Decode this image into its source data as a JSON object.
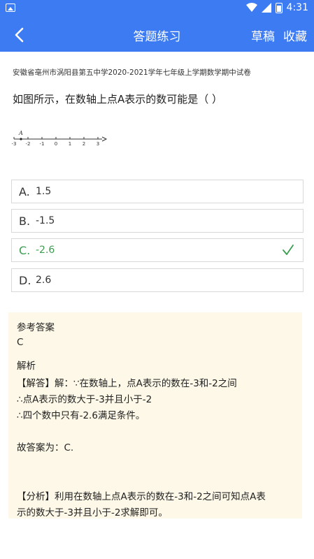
{
  "status_bar": {
    "time": "4:31"
  },
  "header": {
    "title": "答题练习",
    "actions": {
      "draft": "草稿",
      "favorite": "收藏"
    }
  },
  "question": {
    "source": "安徽省亳州市涡阳县第五中学2020-2021学年七年级上学期数学期中试卷",
    "text": "如图所示，在数轴上点A表示的数可能是（     ）",
    "number_line": {
      "point_label": "A",
      "ticks": [
        "-3",
        "-2",
        "-1",
        "0",
        "1",
        "2",
        "3"
      ]
    },
    "options": [
      {
        "letter": "A.",
        "text": "1.5"
      },
      {
        "letter": "B.",
        "text": "-1.5"
      },
      {
        "letter": "C.",
        "text": "-2.6",
        "correct": true
      },
      {
        "letter": "D.",
        "text": "2.6"
      }
    ]
  },
  "answer": {
    "ref_label": "参考答案",
    "ref_value": "C",
    "analysis_label": "解析",
    "solution_line1": "【解答】解：∵在数轴上，点A表示的数在-3和-2之间",
    "solution_line2": "∴点A表示的数大于-3并且小于-2",
    "solution_line3": "∴四个数中只有-2.6满足条件。",
    "conclusion": "故答案为：C.",
    "analysis_line1": "【分析】利用在数轴上点A表示的数在-3和-2之间可知点A表",
    "analysis_line2": "示的数大于-3并且小于-2求解即可。"
  },
  "colors": {
    "primary": "#3d7bf2",
    "correct": "#3a9d4f",
    "answer_bg": "#fdf8e7"
  }
}
